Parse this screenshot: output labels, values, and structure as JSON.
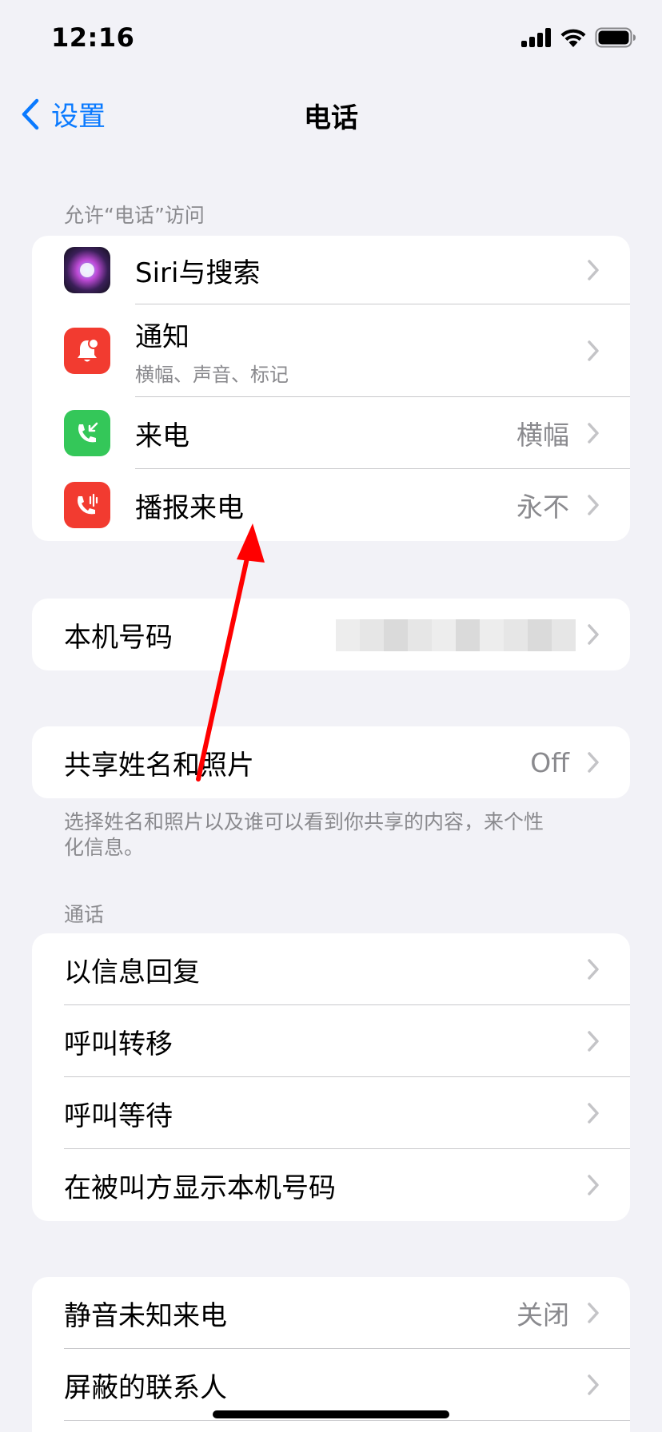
{
  "status_bar": {
    "time": "12:16"
  },
  "nav": {
    "back_label": "设置",
    "title": "电话"
  },
  "section_access": {
    "header": "允许“电话”访问",
    "rows": [
      {
        "label": "Siri与搜索",
        "value": ""
      },
      {
        "label": "通知",
        "sublabel": "横幅、声音、标记",
        "value": ""
      },
      {
        "label": "来电",
        "value": "横幅"
      },
      {
        "label": "播报来电",
        "value": "永不"
      }
    ]
  },
  "section_number": {
    "rows": [
      {
        "label": "本机号码"
      }
    ]
  },
  "section_share": {
    "rows": [
      {
        "label": "共享姓名和照片",
        "value": "Off"
      }
    ],
    "footer": "选择姓名和照片以及谁可以看到你共享的内容，来个性化信息。"
  },
  "section_calls": {
    "header": "通话",
    "rows": [
      {
        "label": "以信息回复"
      },
      {
        "label": "呼叫转移"
      },
      {
        "label": "呼叫等待"
      },
      {
        "label": "在被叫方显示本机号码"
      }
    ]
  },
  "section_silence": {
    "rows": [
      {
        "label": "静音未知来电",
        "value": "关闭"
      },
      {
        "label": "屏蔽的联系人",
        "value": ""
      }
    ]
  },
  "colors": {
    "accent": "#0a7aff",
    "red_icon": "#f23b30",
    "green_icon": "#34c759",
    "annotation_arrow": "#ff0000"
  }
}
